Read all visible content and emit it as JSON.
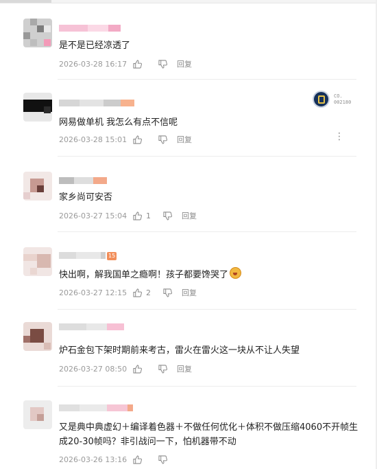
{
  "actions": {
    "reply": "回复"
  },
  "comments": [
    {
      "content": "是不是已经凉透了",
      "time": "2026-03-28 16:17",
      "likes": ""
    },
    {
      "content": "网易做单机 我怎么有点不信呢",
      "time": "2026-03-28 15:01",
      "likes": "",
      "badge": {
        "line1": "CO.",
        "line2": "002180"
      }
    },
    {
      "content": "家乡尚可安否",
      "time": "2026-03-27 15:04",
      "likes": "1"
    },
    {
      "content": "快出啊，解我国单之瘾啊！孩子都要馋哭了",
      "time": "2026-03-27 12:15",
      "likes": "2",
      "badge_number": "15"
    },
    {
      "content": "炉石金包下架时期前来考古，雷火在雷火这一块从不让人失望",
      "time": "2026-03-27 08:50",
      "likes": ""
    },
    {
      "content": "又是典中典虚幻＋编译着色器＋不做任何优化＋体积不做压缩4060不开帧生成20-30帧吗？非引战问一下，怕机器带不动",
      "time": "2026-03-26 13:16",
      "likes": ""
    }
  ],
  "colors": {
    "text": "#222222",
    "meta": "#9a9a9a",
    "name_highlight": "#f7b28e",
    "name_pink": "#f4b9cf"
  }
}
